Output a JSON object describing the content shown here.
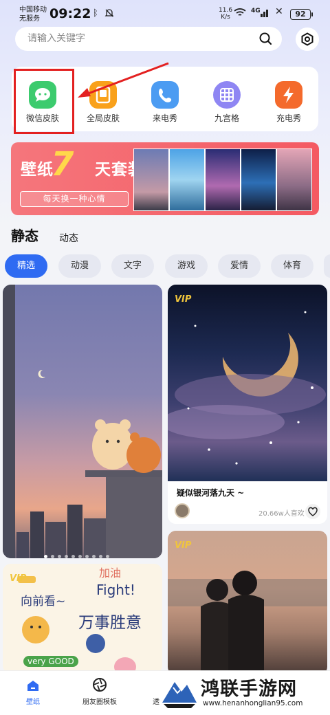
{
  "status_bar": {
    "carrier_line1": "中国移动",
    "carrier_line2": "无服务",
    "time": "09:22",
    "net_speed_value": "11.6",
    "net_speed_unit": "K/s",
    "signal_label": "4G",
    "battery": "92"
  },
  "search": {
    "placeholder": "请输入关键字"
  },
  "categories": [
    {
      "label": "微信皮肤",
      "color": "#3ccb6e",
      "icon": "wechat-icon"
    },
    {
      "label": "全局皮肤",
      "color": "#f9a11b",
      "icon": "theme-icon"
    },
    {
      "label": "来电秀",
      "color": "#4c9cf2",
      "icon": "phone-icon"
    },
    {
      "label": "九宫格",
      "color": "#8f86f3",
      "icon": "grid-icon"
    },
    {
      "label": "充电秀",
      "color": "#f46a2c",
      "icon": "lightning-icon"
    }
  ],
  "banner": {
    "title_prefix": "壁纸",
    "number": "7",
    "title_suffix": "天套装",
    "subtitle": "每天换一种心情"
  },
  "content_tabs": {
    "static": "静态",
    "dynamic": "动态"
  },
  "chips": [
    "精选",
    "动漫",
    "文字",
    "游戏",
    "爱情",
    "体育"
  ],
  "cards": {
    "vip_badge": "VIP",
    "card2_title": "疑似银河落九天 ~",
    "card2_likes": "20.66w人喜欢",
    "card3_texts": [
      "加油",
      "向前看~",
      "Fight!",
      "万事胜意",
      "very GOOD"
    ]
  },
  "bottom_nav": [
    {
      "label": "壁纸",
      "active": true
    },
    {
      "label": "朋友圈模板",
      "active": false
    },
    {
      "label": "透",
      "active": false
    }
  ],
  "watermark": {
    "brand": "鸿联手游网",
    "url": "www.henanhonglian95.com"
  }
}
